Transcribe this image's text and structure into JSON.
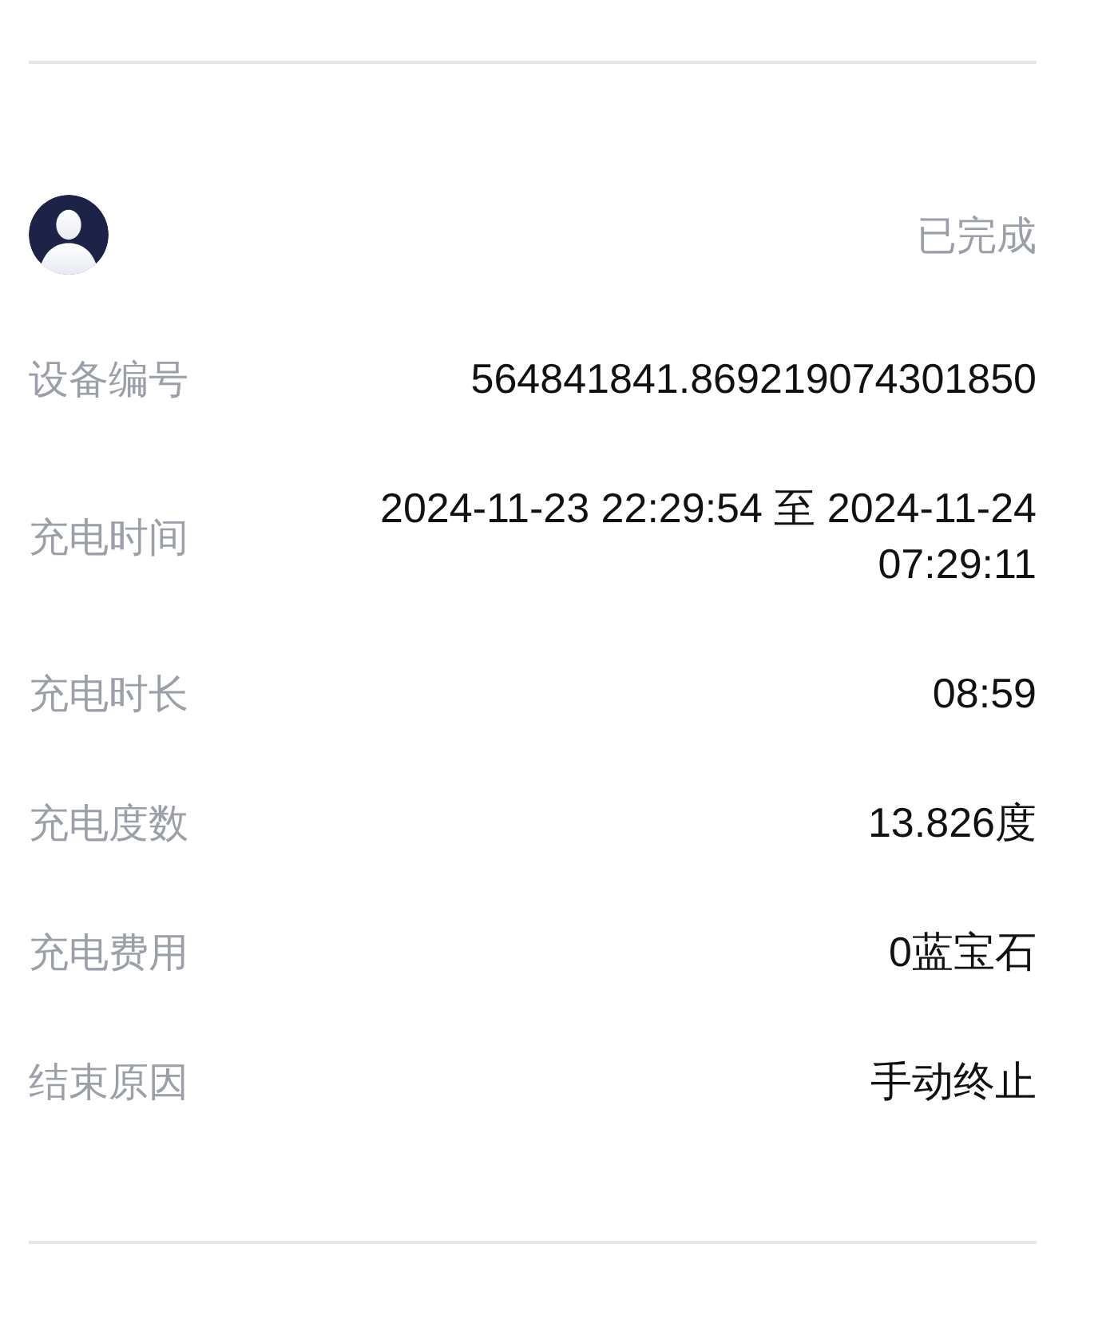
{
  "header": {
    "status": "已完成"
  },
  "details": [
    {
      "label": "设备编号",
      "value": "564841841.869219074301850"
    },
    {
      "label": "充电时间",
      "value": "2024-11-23 22:29:54 至 2024-11-24 07:29:11"
    },
    {
      "label": "充电时长",
      "value": "08:59"
    },
    {
      "label": "充电度数",
      "value": "13.826度"
    },
    {
      "label": "充电费用",
      "value": "0蓝宝石"
    },
    {
      "label": "结束原因",
      "value": "手动终止"
    }
  ]
}
